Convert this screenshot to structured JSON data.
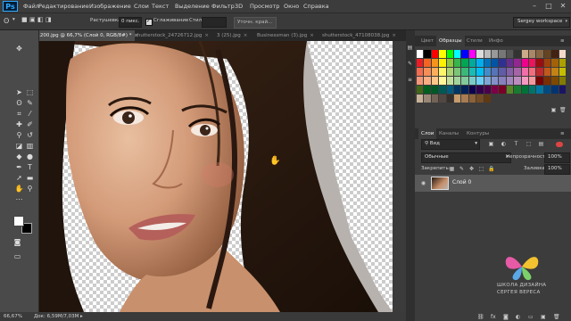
{
  "app": {
    "logo": "Ps"
  },
  "menu": [
    "Файл",
    "Редактирование",
    "Изображение",
    "Слои",
    "Текст",
    "Выделение",
    "Фильтр",
    "3D",
    "Просмотр",
    "Окно",
    "Справка"
  ],
  "options": {
    "feather_label": "Растушевка:",
    "feather_value": "0 пикс.",
    "antialias_label": "Сглаживание",
    "style_label": "Стиль:",
    "refine_label": "Уточн. край...",
    "workspace": "Sergey workspace"
  },
  "tabs": [
    {
      "label": "Alina - 1920x1200.jpg @ 66,7% (Слой 0, RGB/8#) *",
      "active": true
    },
    {
      "label": "shutterstock_24726712.jpg",
      "active": false
    },
    {
      "label": "3 (25).jpg",
      "active": false
    },
    {
      "label": "Businessman (3).jpg",
      "active": false
    },
    {
      "label": "shutterstock_47108038.jpg",
      "active": false
    }
  ],
  "status": {
    "zoom": "66,67%",
    "doc": "Док: 6,59M/7,03M"
  },
  "swatches_panel": {
    "tabs": [
      "Цвет",
      "Образцы",
      "Стили",
      "Инфо"
    ],
    "active": 1,
    "colors": {
      "row1": [
        "#ffffff",
        "#000000",
        "#ff0000",
        "#ffff00",
        "#00ff00",
        "#00ffff",
        "#0000ff",
        "#ff00ff",
        "#dddddd",
        "#bbbbbb",
        "#999999",
        "#777777",
        "#555555",
        "#333333",
        "#ccaa88",
        "#aa8866",
        "#886644",
        "#664422",
        "#442211",
        "#f2d9c9"
      ],
      "row2": [
        "#ed1c24",
        "#f26522",
        "#f7941d",
        "#fff200",
        "#8dc63f",
        "#39b54a",
        "#00a651",
        "#00a99d",
        "#00aeef",
        "#0072bc",
        "#0054a6",
        "#2e3192",
        "#662d91",
        "#92278f",
        "#ec008c",
        "#ed145b",
        "#9e0b0f",
        "#a0410d",
        "#a36209",
        "#aba000"
      ],
      "row3": [
        "#f26c4f",
        "#f68e56",
        "#fbaf5d",
        "#fff568",
        "#acd372",
        "#7cc576",
        "#3bb878",
        "#1abbb4",
        "#00bff3",
        "#438ccb",
        "#5574b9",
        "#605ca8",
        "#855fa8",
        "#a763a8",
        "#f06ea9",
        "#f26d7d",
        "#c1272d",
        "#c2581b",
        "#c48116",
        "#c6bd00"
      ],
      "row4": [
        "#f69679",
        "#f9ad81",
        "#fdc68a",
        "#fff799",
        "#c4df9b",
        "#a3d39c",
        "#82ca9c",
        "#7accc8",
        "#6dcff6",
        "#7da7d9",
        "#8393ca",
        "#8781bd",
        "#a187be",
        "#bd8cbf",
        "#f49ac1",
        "#f5989d",
        "#790000",
        "#7b2e00",
        "#7d4900",
        "#827b00"
      ],
      "row5": [
        "#406618",
        "#005e20",
        "#005826",
        "#005952",
        "#005b7f",
        "#003663",
        "#002157",
        "#0d004c",
        "#32004b",
        "#4b0049",
        "#7b0046",
        "#7a0026",
        "#598527",
        "#197b30",
        "#007236",
        "#00746b",
        "#0076a3",
        "#004a80",
        "#003471",
        "#1b1464"
      ],
      "row6": [
        "#c7b299",
        "#998675",
        "#736357",
        "#534741",
        "#37302d",
        "#c69c6d",
        "#a67c52",
        "#8c6239",
        "#754c24",
        "#603913"
      ]
    }
  },
  "layers_panel": {
    "tabs": [
      "Слои",
      "Каналы",
      "Контуры"
    ],
    "filter": "Вид",
    "blend": "Обычные",
    "opacity_label": "Непрозрачность:",
    "opacity": "100%",
    "lock_label": "Закрепить:",
    "fill_label": "Заливка:",
    "fill": "100%",
    "layer_name": "Слой 0"
  },
  "watermark": {
    "line1": "ШКОЛА ДИЗАЙНА",
    "line2": "СЕРГЕЯ ВЕРЕСА"
  },
  "colors": {
    "accent": "#31a8ff",
    "foreground": "#ffffff",
    "background": "#000000"
  }
}
